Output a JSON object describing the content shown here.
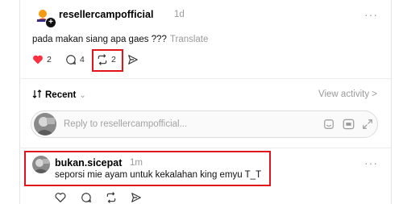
{
  "post": {
    "username": "resellercampofficial",
    "time": "1d",
    "more": "···",
    "text": "pada makan siang apa gaes ???",
    "translate": "Translate",
    "actions": {
      "likes": "2",
      "comments": "4",
      "reposts": "2"
    }
  },
  "replies_header": {
    "sort_label": "Recent",
    "view_activity": "View activity >"
  },
  "reply_bar": {
    "placeholder": "Reply to resellercampofficial..."
  },
  "comment": {
    "username": "bukan.sicepat",
    "time": "1m",
    "more": "···",
    "text": "seporsi mie ayam untuk kekalahan king emyu T_T"
  },
  "colors": {
    "like_red": "#ff3040",
    "highlight_red": "#e0141b",
    "muted": "#9a9a9a"
  },
  "icons": [
    "heart-icon",
    "comment-icon",
    "repost-icon",
    "share-icon",
    "sort-icon",
    "gif-icon",
    "sticker-icon",
    "expand-icon"
  ]
}
